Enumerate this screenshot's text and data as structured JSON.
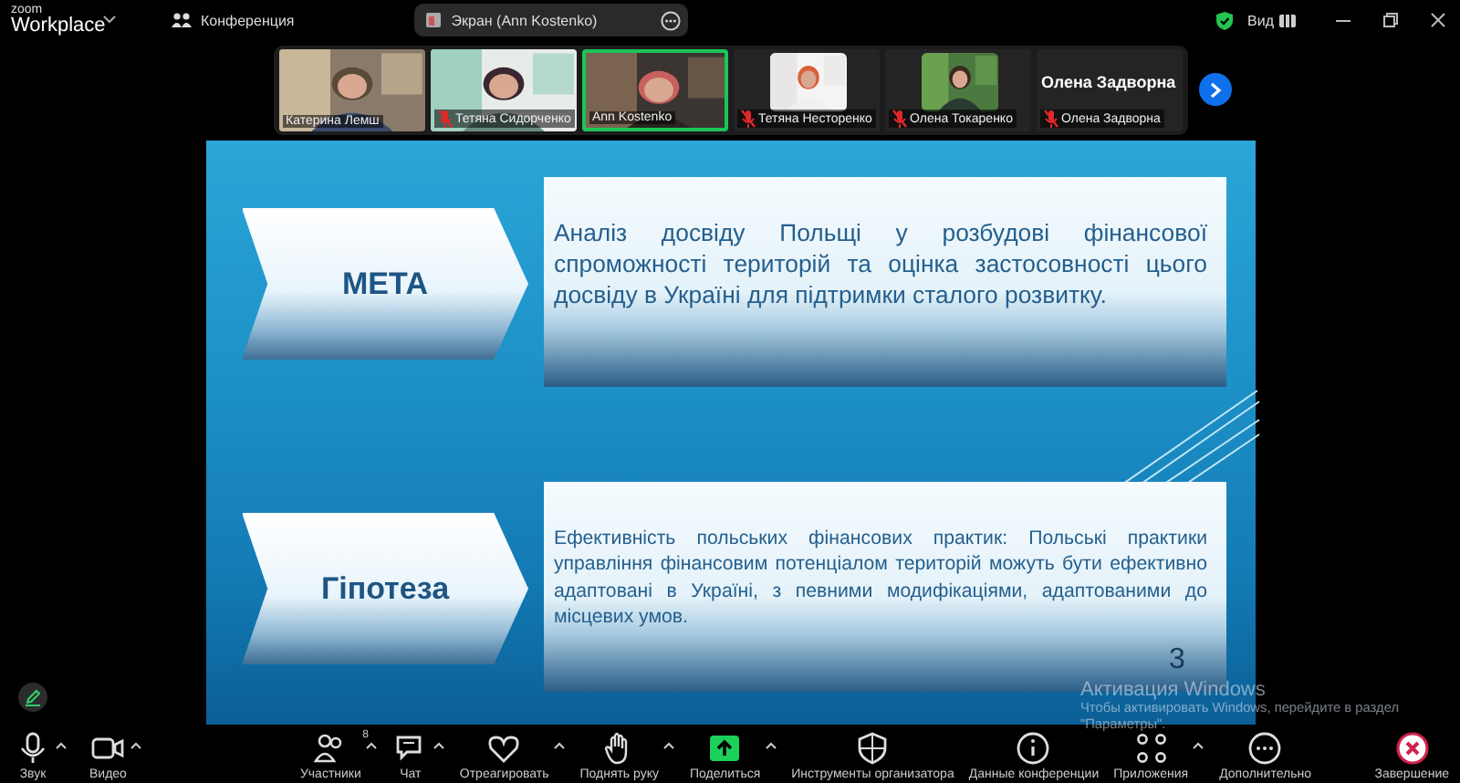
{
  "app": {
    "logo_top": "zoom",
    "logo_bottom": "Workplace"
  },
  "meeting_menu": {
    "label": "Конференция"
  },
  "share_pill": {
    "label": "Экран (Ann Kostenko)"
  },
  "view_button": {
    "label": "Вид"
  },
  "participants": [
    {
      "kind": "video",
      "name": "Катерина Лемш",
      "muted": false,
      "speaking": false
    },
    {
      "kind": "video",
      "name": "Тетяна Сидорченко",
      "muted": true,
      "speaking": false
    },
    {
      "kind": "video",
      "name": "Ann Kostenko",
      "muted": false,
      "speaking": true
    },
    {
      "kind": "avatar",
      "name": "Тетяна Несторенко",
      "muted": true,
      "speaking": false
    },
    {
      "kind": "avatar",
      "name": "Олена Токаренко",
      "muted": true,
      "speaking": false
    },
    {
      "kind": "name",
      "display_name": "Олена Задворна",
      "name": "Олена Задворна",
      "muted": true,
      "speaking": false
    }
  ],
  "slide": {
    "blocks": [
      {
        "label": "МЕТА",
        "text": "Аналіз досвіду Польщі у розбудові фінансової спроможності територій та оцінка застосовності цього досвіду в Україні для підтримки сталого розвитку."
      },
      {
        "label": "Гіпотеза",
        "text": "Ефективність польських фінансових практик: Польські практики управління фінансовим потенціалом територій можуть бути ефективно адаптовані в Україні, з певними модифікаціями, адаптованими до місцевих умов."
      }
    ],
    "slide_number": "3"
  },
  "activation": {
    "title": "Активация Windows",
    "line1": "Чтобы активировать Windows, перейдите в раздел",
    "line2": "\"Параметры\"."
  },
  "toolbar": [
    {
      "kind": "mic",
      "label": "Звук",
      "caret": true
    },
    {
      "kind": "camera",
      "label": "Видео",
      "caret": true
    },
    {
      "kind": "people",
      "label": "Участники",
      "badge": "8",
      "caret": true
    },
    {
      "kind": "chat",
      "label": "Чат",
      "caret": true
    },
    {
      "kind": "heart",
      "label": "Отреагировать",
      "caret": true
    },
    {
      "kind": "hand",
      "label": "Поднять руку",
      "caret": true
    },
    {
      "kind": "share",
      "label": "Поделиться",
      "caret": true
    },
    {
      "kind": "shield",
      "label": "Инструменты организатора",
      "caret": false
    },
    {
      "kind": "info",
      "label": "Данные конференции",
      "caret": false
    },
    {
      "kind": "apps",
      "label": "Приложения",
      "caret": true
    },
    {
      "kind": "more",
      "label": "Дополнительно",
      "caret": false
    },
    {
      "kind": "end",
      "label": "Завершение",
      "caret": false
    }
  ]
}
